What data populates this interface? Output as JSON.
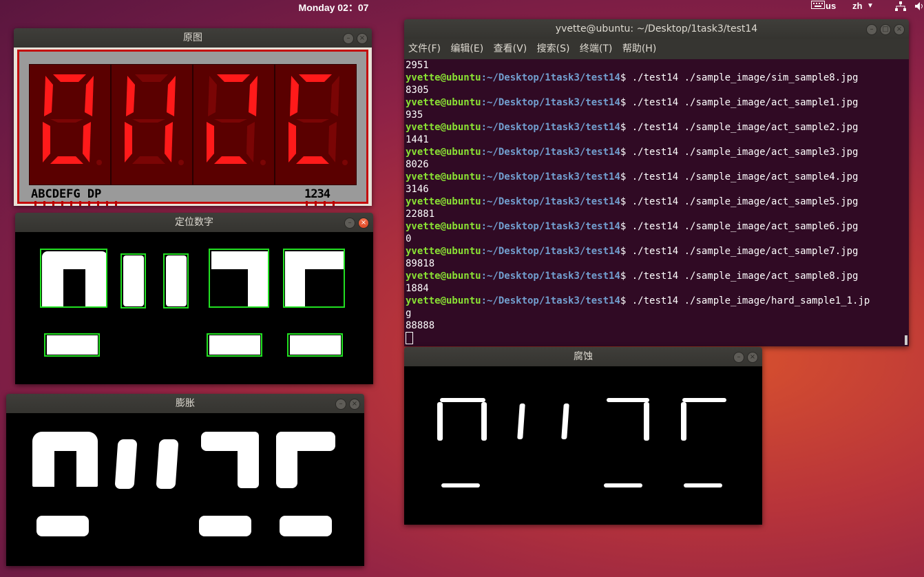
{
  "top_panel": {
    "clock": "Monday 02：07",
    "keyboard_layout": "us",
    "input_method": "zh",
    "icons": [
      "keyboard-icon",
      "dropdown-icon",
      "network-icon",
      "volume-icon"
    ]
  },
  "windows": {
    "original": {
      "title": "原图",
      "segment_labels_left": "ABCDEFG DP",
      "segment_labels_right": "1234"
    },
    "locate": {
      "title": "定位数字"
    },
    "dilate": {
      "title": "膨胀"
    },
    "erode": {
      "title": "腐蚀"
    },
    "terminal": {
      "title": "yvette@ubuntu: ~/Desktop/1task3/test14",
      "menu": [
        "文件(F)",
        "编辑(E)",
        "查看(V)",
        "搜索(S)",
        "终端(T)",
        "帮助(H)"
      ],
      "prompt_user": "yvette@ubuntu",
      "prompt_path": ":~/Desktop/1task3/test14",
      "prompt_suffix": "$ ",
      "first_output": "2951",
      "entries": [
        {
          "cmd": "./test14 ./sample_image/sim_sample8.jpg",
          "out": "8305"
        },
        {
          "cmd": "./test14 ./sample_image/act_sample1.jpg",
          "out": "935"
        },
        {
          "cmd": "./test14 ./sample_image/act_sample2.jpg",
          "out": "1441"
        },
        {
          "cmd": "./test14 ./sample_image/act_sample3.jpg",
          "out": "8026"
        },
        {
          "cmd": "./test14 ./sample_image/act_sample4.jpg",
          "out": "3146"
        },
        {
          "cmd": "./test14 ./sample_image/act_sample5.jpg",
          "out": "22881"
        },
        {
          "cmd": "./test14 ./sample_image/act_sample6.jpg",
          "out": "0"
        },
        {
          "cmd": "./test14 ./sample_image/act_sample7.jpg",
          "out": "89818"
        },
        {
          "cmd": "./test14 ./sample_image/act_sample8.jpg",
          "out": "1884"
        }
      ],
      "last_cmd_line1": "./test14 ./sample_image/hard_sample1_1.jp",
      "last_cmd_line2": "g",
      "last_out": "88888"
    }
  },
  "colors": {
    "terminal_bg": "#300a24",
    "prompt_user": "#8ae234",
    "prompt_path": "#729fcf",
    "box": "#22e022",
    "segment_on": "#ff1a1a"
  }
}
